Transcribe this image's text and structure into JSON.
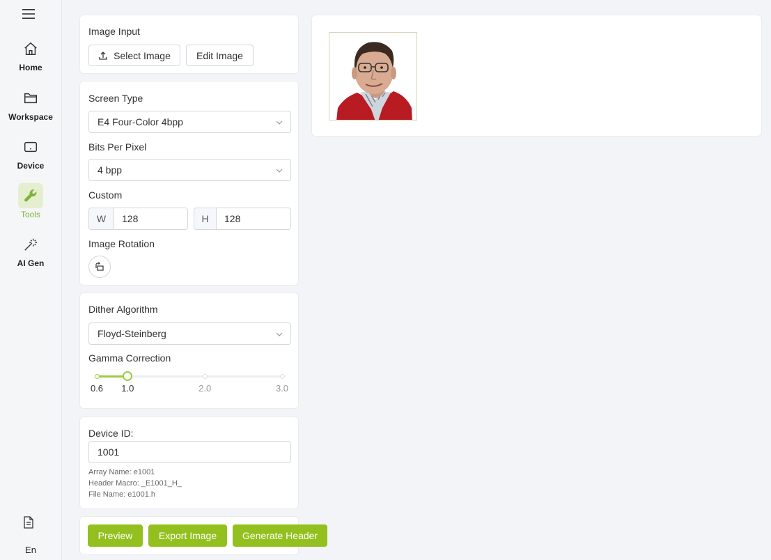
{
  "sidebar": {
    "items": [
      {
        "label": "Home",
        "icon": "home-icon"
      },
      {
        "label": "Workspace",
        "icon": "folder-icon"
      },
      {
        "label": "Device",
        "icon": "device-icon"
      },
      {
        "label": "Tools",
        "icon": "wrench-icon",
        "active": true
      },
      {
        "label": "AI Gen",
        "icon": "magic-wand-icon"
      }
    ],
    "language": "En"
  },
  "image_input": {
    "title": "Image Input",
    "select_label": "Select Image",
    "edit_label": "Edit Image"
  },
  "screen": {
    "type_label": "Screen Type",
    "type_value": "E4 Four-Color 4bpp",
    "bpp_label": "Bits Per Pixel",
    "bpp_value": "4 bpp",
    "custom_label": "Custom",
    "width_prefix": "W",
    "width_value": "128",
    "height_prefix": "H",
    "height_value": "128",
    "rotation_label": "Image Rotation"
  },
  "dither": {
    "label": "Dither Algorithm",
    "value": "Floyd-Steinberg",
    "gamma_label": "Gamma Correction",
    "gamma_value": 1.0,
    "gamma_min": 0.6,
    "gamma_max": 3.0,
    "marks": [
      "0.6",
      "1.0",
      "2.0",
      "3.0"
    ]
  },
  "device": {
    "label": "Device ID:",
    "value": "1001",
    "array_name": "Array Name: e1001",
    "header_macro": "Header Macro: _E1001_H_",
    "file_name": "File Name: e1001.h"
  },
  "actions": {
    "preview": "Preview",
    "export": "Export Image",
    "generate": "Generate Header"
  },
  "colors": {
    "accent": "#93c01f",
    "active_bg": "#e5efcf"
  }
}
